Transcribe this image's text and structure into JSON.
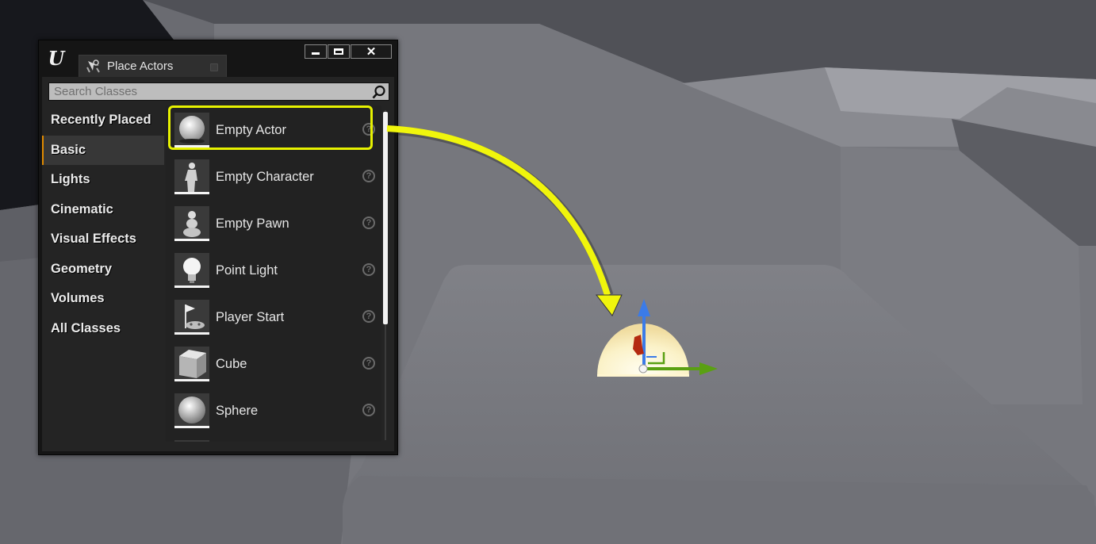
{
  "window": {
    "tab_title": "Place Actors",
    "tab_icon": "place-actors-icon"
  },
  "search": {
    "placeholder": "Search Classes",
    "value": ""
  },
  "categories": [
    {
      "label": "Recently Placed",
      "active": false
    },
    {
      "label": "Basic",
      "active": true
    },
    {
      "label": "Lights",
      "active": false
    },
    {
      "label": "Cinematic",
      "active": false
    },
    {
      "label": "Visual Effects",
      "active": false
    },
    {
      "label": "Geometry",
      "active": false
    },
    {
      "label": "Volumes",
      "active": false
    },
    {
      "label": "All Classes",
      "active": false
    }
  ],
  "items": [
    {
      "label": "Empty Actor",
      "icon": "empty-actor-icon",
      "selected": true
    },
    {
      "label": "Empty Character",
      "icon": "character-icon",
      "selected": false
    },
    {
      "label": "Empty Pawn",
      "icon": "pawn-icon",
      "selected": false
    },
    {
      "label": "Point Light",
      "icon": "light-bulb-icon",
      "selected": false
    },
    {
      "label": "Player Start",
      "icon": "player-start-icon",
      "selected": false
    },
    {
      "label": "Cube",
      "icon": "cube-icon",
      "selected": false
    },
    {
      "label": "Sphere",
      "icon": "sphere-icon",
      "selected": false
    }
  ],
  "help_glyph": "?",
  "colors": {
    "highlight": "#e7f200",
    "active_category_accent": "#e08a00",
    "gizmo_z": "#3b7be8",
    "gizmo_y": "#5aa012",
    "gizmo_x": "#b42a10"
  }
}
